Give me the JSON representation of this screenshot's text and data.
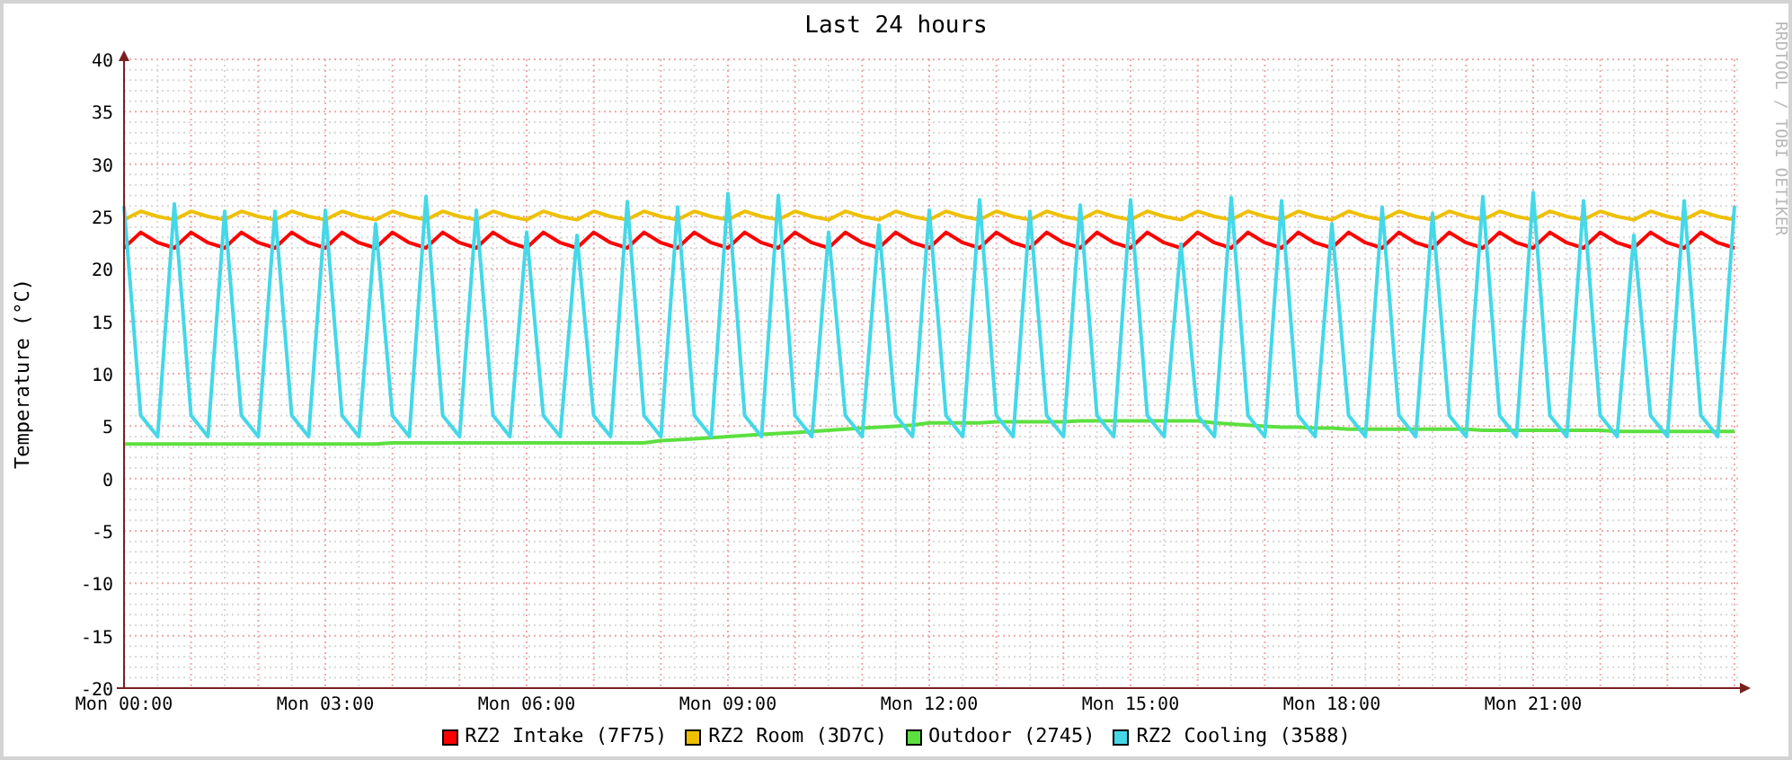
{
  "title": "Last 24 hours",
  "credit": "RRDTOOL / TOBI OETIKER",
  "chart_data": {
    "type": "line",
    "grid": true,
    "ylabel": "Temperature (°C)",
    "ylim": [
      -20,
      40
    ],
    "yticks": [
      -20,
      -15,
      -10,
      -5,
      0,
      5,
      10,
      15,
      20,
      25,
      30,
      35,
      40
    ],
    "categories": [
      "Mon 00:00",
      null,
      null,
      null,
      null,
      null,
      null,
      null,
      null,
      null,
      null,
      null,
      "Mon 03:00",
      null,
      null,
      null,
      null,
      null,
      null,
      null,
      null,
      null,
      null,
      null,
      "Mon 06:00",
      null,
      null,
      null,
      null,
      null,
      null,
      null,
      null,
      null,
      null,
      null,
      "Mon 09:00",
      null,
      null,
      null,
      null,
      null,
      null,
      null,
      null,
      null,
      null,
      null,
      "Mon 12:00",
      null,
      null,
      null,
      null,
      null,
      null,
      null,
      null,
      null,
      null,
      null,
      "Mon 15:00",
      null,
      null,
      null,
      null,
      null,
      null,
      null,
      null,
      null,
      null,
      null,
      "Mon 18:00",
      null,
      null,
      null,
      null,
      null,
      null,
      null,
      null,
      null,
      null,
      null,
      "Mon 21:00",
      null,
      null,
      null,
      null,
      null,
      null,
      null,
      null,
      null,
      null,
      null,
      null
    ],
    "series": [
      {
        "name": "RZ2 Intake (7F75)",
        "color": "#ff0000",
        "values": [
          22,
          23.5,
          22.5,
          22,
          23.5,
          22.5,
          22,
          23.5,
          22.5,
          22,
          23.5,
          22.5,
          22,
          23.5,
          22.5,
          22,
          23.5,
          22.5,
          22,
          23.5,
          22.5,
          22,
          23.5,
          22.5,
          22,
          23.5,
          22.5,
          22,
          23.5,
          22.5,
          22,
          23.5,
          22.5,
          22,
          23.5,
          22.5,
          22,
          23.5,
          22.5,
          22,
          23.5,
          22.5,
          22,
          23.5,
          22.5,
          22,
          23.5,
          22.5,
          22,
          23.5,
          22.5,
          22,
          23.5,
          22.5,
          22,
          23.5,
          22.5,
          22,
          23.5,
          22.5,
          22,
          23.5,
          22.5,
          22,
          23.5,
          22.5,
          22,
          23.5,
          22.5,
          22,
          23.5,
          22.5,
          22,
          23.5,
          22.5,
          22,
          23.5,
          22.5,
          22,
          23.5,
          22.5,
          22,
          23.5,
          22.5,
          22,
          23.5,
          22.5,
          22,
          23.5,
          22.5,
          22,
          23.5,
          22.5,
          22,
          23.5,
          22.5,
          22
        ]
      },
      {
        "name": "RZ2 Room (3D7C)",
        "color": "#eec000",
        "values": [
          24.7,
          25.5,
          25,
          24.7,
          25.5,
          25,
          24.7,
          25.5,
          25,
          24.7,
          25.5,
          25,
          24.7,
          25.5,
          25,
          24.7,
          25.5,
          25,
          24.7,
          25.5,
          25,
          24.7,
          25.5,
          25,
          24.7,
          25.5,
          25,
          24.7,
          25.5,
          25,
          24.7,
          25.5,
          25,
          24.7,
          25.5,
          25,
          24.7,
          25.5,
          25,
          24.7,
          25.5,
          25,
          24.7,
          25.5,
          25,
          24.7,
          25.5,
          25,
          24.7,
          25.5,
          25,
          24.7,
          25.5,
          25,
          24.7,
          25.5,
          25,
          24.7,
          25.5,
          25,
          24.7,
          25.5,
          25,
          24.7,
          25.5,
          25,
          24.7,
          25.5,
          25,
          24.7,
          25.5,
          25,
          24.7,
          25.5,
          25,
          24.7,
          25.5,
          25,
          24.7,
          25.5,
          25,
          24.7,
          25.5,
          25,
          24.7,
          25.5,
          25,
          24.7,
          25.5,
          25,
          24.7,
          25.5,
          25,
          24.7,
          25.5,
          25,
          24.7
        ]
      },
      {
        "name": "Outdoor (2745)",
        "color": "#5ce040",
        "values": [
          3.3,
          3.3,
          3.3,
          3.3,
          3.3,
          3.3,
          3.3,
          3.3,
          3.3,
          3.3,
          3.3,
          3.3,
          3.3,
          3.3,
          3.3,
          3.3,
          3.4,
          3.4,
          3.4,
          3.4,
          3.4,
          3.4,
          3.4,
          3.4,
          3.4,
          3.4,
          3.4,
          3.4,
          3.4,
          3.4,
          3.4,
          3.4,
          3.6,
          3.7,
          3.8,
          3.9,
          4,
          4.1,
          4.2,
          4.3,
          4.4,
          4.5,
          4.6,
          4.7,
          4.8,
          4.9,
          5,
          5.1,
          5.3,
          5.3,
          5.3,
          5.3,
          5.4,
          5.4,
          5.4,
          5.4,
          5.4,
          5.5,
          5.5,
          5.5,
          5.5,
          5.5,
          5.5,
          5.5,
          5.5,
          5.3,
          5.2,
          5.1,
          5,
          4.9,
          4.9,
          4.8,
          4.8,
          4.7,
          4.7,
          4.7,
          4.7,
          4.7,
          4.7,
          4.7,
          4.7,
          4.6,
          4.6,
          4.6,
          4.6,
          4.6,
          4.6,
          4.6,
          4.6,
          4.5,
          4.5,
          4.5,
          4.5,
          4.5,
          4.5,
          4.5,
          4.5
        ]
      },
      {
        "name": "RZ2 Cooling (3588)",
        "color": "#44d8e8",
        "values": [
          26,
          6,
          4,
          26.2,
          6,
          4,
          25.5,
          6,
          4,
          25.5,
          6,
          4,
          25.6,
          6,
          4,
          24.3,
          6,
          4,
          26.9,
          6,
          4,
          25.6,
          6,
          4,
          23.5,
          6,
          4,
          23.2,
          6,
          4,
          26.4,
          6,
          4,
          25.9,
          6,
          4,
          27.2,
          6,
          4,
          27,
          6,
          4,
          23.5,
          6,
          4,
          24.2,
          6,
          4,
          25.6,
          6,
          4,
          26.6,
          6,
          4,
          25.5,
          6,
          4,
          26.1,
          6,
          4,
          26.6,
          6,
          4,
          22.4,
          6,
          4,
          26.8,
          6,
          4,
          26.5,
          6,
          4,
          24.3,
          6,
          4,
          25.9,
          6,
          4,
          25.3,
          6,
          4,
          26.9,
          6,
          4,
          27.3,
          6,
          4,
          26.5,
          6,
          4,
          23.2,
          6,
          4,
          26.5,
          6,
          4,
          26
        ]
      }
    ]
  }
}
